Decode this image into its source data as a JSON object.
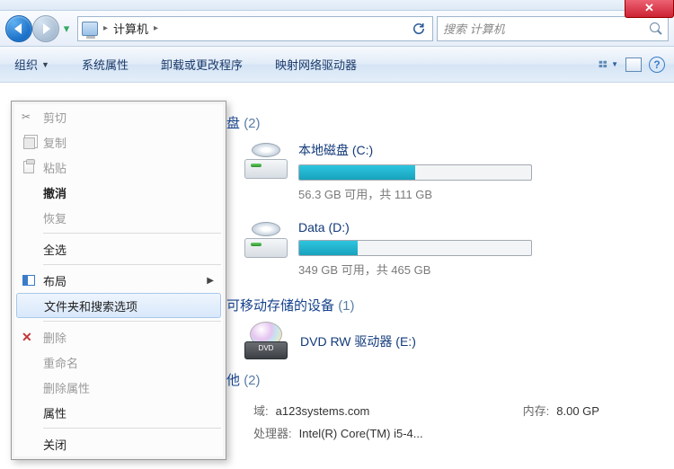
{
  "window": {
    "close_symbol": "✕"
  },
  "nav": {
    "breadcrumb_root": "计算机",
    "search_placeholder": "搜索 计算机"
  },
  "toolbar": {
    "organize": "组织",
    "system_props": "系统属性",
    "uninstall": "卸载或更改程序",
    "map_drive": "映射网络驱动器",
    "help_symbol": "?"
  },
  "context_menu": {
    "cut": "剪切",
    "copy": "复制",
    "paste": "粘贴",
    "undo": "撤消",
    "redo": "恢复",
    "select_all": "全选",
    "layout": "布局",
    "folder_options": "文件夹和搜索选项",
    "delete": "删除",
    "rename": "重命名",
    "delete_props": "删除属性",
    "properties": "属性",
    "close": "关闭"
  },
  "content": {
    "group_hdd_label": "盘",
    "group_hdd_count": "(2)",
    "drive_c": {
      "label": "本地磁盘 (C:)",
      "stats": "56.3 GB 可用，共 111 GB",
      "fill_pct": 50
    },
    "drive_d": {
      "label": "Data (D:)",
      "stats": "349 GB 可用，共 465 GB",
      "fill_pct": 25
    },
    "group_removable_label": "可移动存储的设备",
    "group_removable_count": "(1)",
    "dvd_label": "DVD RW 驱动器 (E:)",
    "dvd_tray_text": "DVD",
    "group_other_label": "他",
    "group_other_count": "(2)",
    "sys_domain_label": "域:",
    "sys_domain_value": "a123systems.com",
    "sys_mem_label": "内存:",
    "sys_mem_value": "8.00 GP",
    "sys_cpu_label": "处理器:",
    "sys_cpu_value": "Intel(R) Core(TM) i5-4..."
  }
}
